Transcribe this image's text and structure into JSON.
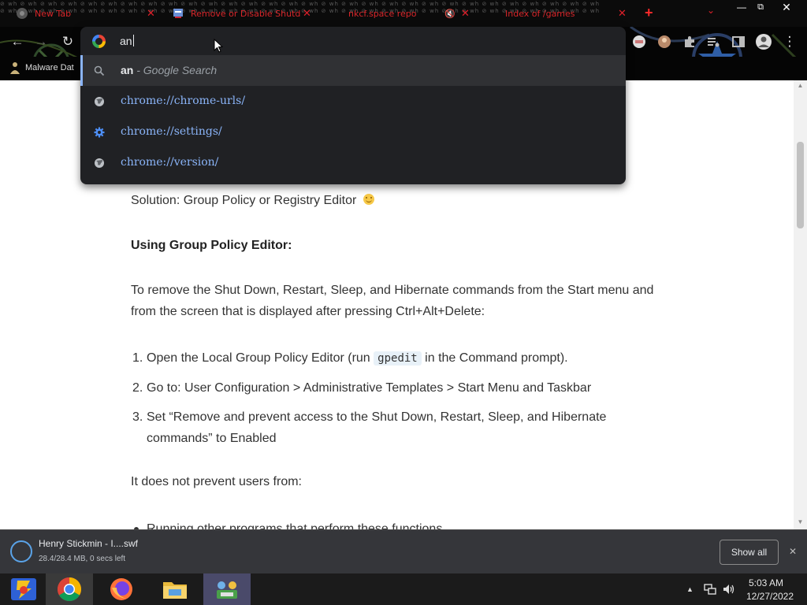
{
  "tabs": [
    {
      "title": "New Tab",
      "icon": "chrome-icon"
    },
    {
      "title": "Remove or Disable Shutd",
      "icon": "site-favicon"
    },
    {
      "title": "nkcf.space repo",
      "icon": "none",
      "muted_audio": true
    },
    {
      "title": "Index of /games",
      "icon": "none"
    }
  ],
  "bookmarks": {
    "first_label": "Malware Dat"
  },
  "omnibox": {
    "typed_text": "an",
    "suggestions": [
      {
        "bold": "an",
        "rest": " - Google Search",
        "icon": "search-icon",
        "type": "search"
      },
      {
        "url": "chrome://chrome-urls/",
        "icon": "globe-icon",
        "type": "url"
      },
      {
        "url": "chrome://settings/",
        "icon": "gear-icon",
        "type": "url"
      },
      {
        "url": "chrome://version/",
        "icon": "globe-icon",
        "type": "url"
      }
    ]
  },
  "article": {
    "solution": "Solution: Group Policy or Registry Editor",
    "heading": "Using Group Policy Editor:",
    "intro": "To remove the Shut Down, Restart, Sleep, and Hibernate commands from the Start menu and from the screen that is displayed after pressing Ctrl+Alt+Delete:",
    "steps": [
      {
        "num": "1.",
        "before": "Open the Local Group Policy Editor (run ",
        "code": "gpedit",
        "after": " in the Command prompt)."
      },
      {
        "num": "2.",
        "text": "Go to: User Configuration > Administrative Templates > Start Menu and Taskbar"
      },
      {
        "num": "3.",
        "text": "Set “Remove and prevent access to the Shut Down, Restart, Sleep, and Hibernate commands” to Enabled"
      }
    ],
    "not_prevent": "It does not prevent users from:",
    "bullet": "Running other programs that perform these functions"
  },
  "download": {
    "filename": "Henry Stickmin - I....swf",
    "status": "28.4/28.4 MB, 0 secs left",
    "show_all": "Show all"
  },
  "taskbar": {
    "apps": [
      "flashpoint-icon",
      "chrome-icon",
      "firefox-icon",
      "file-explorer-icon",
      "launcher-icon"
    ],
    "time": "5:03 AM",
    "date": "12/27/2022"
  },
  "colors": {
    "tab_text": "#d8262a",
    "omnibox_bg": "#202124",
    "url_blue": "#8ab4f8",
    "download_bar": "#35363a",
    "taskbar": "#1b1b1b"
  }
}
